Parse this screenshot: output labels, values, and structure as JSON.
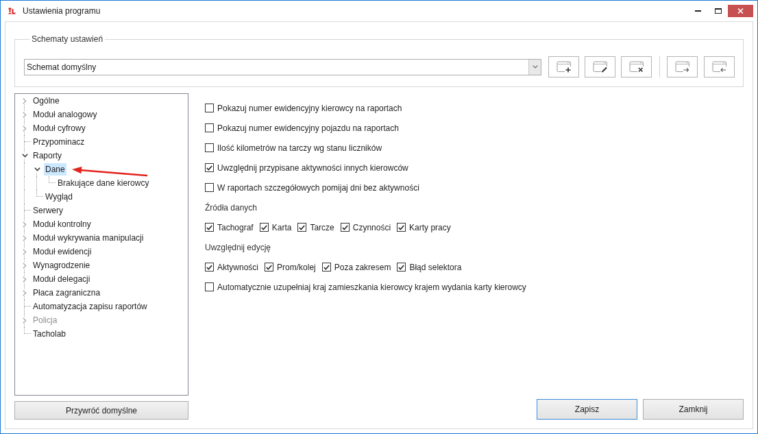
{
  "window": {
    "title": "Ustawienia programu"
  },
  "schemes": {
    "legend": "Schematy ustawień",
    "value": "Schemat domyślny"
  },
  "tree": [
    {
      "label": "Ogólne",
      "kind": "group",
      "expanded": false,
      "selected": false,
      "disabled": false
    },
    {
      "label": "Moduł analogowy",
      "kind": "group",
      "expanded": false,
      "selected": false,
      "disabled": false
    },
    {
      "label": "Moduł cyfrowy",
      "kind": "group",
      "expanded": false,
      "selected": false,
      "disabled": false
    },
    {
      "label": "Przypominacz",
      "kind": "leaf",
      "selected": false,
      "disabled": false
    },
    {
      "label": "Raporty",
      "kind": "group",
      "expanded": true,
      "selected": false,
      "disabled": false,
      "children": [
        {
          "label": "Dane",
          "kind": "group",
          "expanded": true,
          "selected": true,
          "disabled": false,
          "children": [
            {
              "label": "Brakujące dane kierowcy",
              "kind": "leaf",
              "selected": false,
              "disabled": false
            }
          ]
        },
        {
          "label": "Wygląd",
          "kind": "leaf",
          "selected": false,
          "disabled": false
        }
      ]
    },
    {
      "label": "Serwery",
      "kind": "leaf",
      "selected": false,
      "disabled": false
    },
    {
      "label": "Moduł kontrolny",
      "kind": "group",
      "expanded": false,
      "selected": false,
      "disabled": false
    },
    {
      "label": "Moduł wykrywania manipulacji",
      "kind": "group",
      "expanded": false,
      "selected": false,
      "disabled": false
    },
    {
      "label": "Moduł ewidencji",
      "kind": "group",
      "expanded": false,
      "selected": false,
      "disabled": false
    },
    {
      "label": "Wynagrodzenie",
      "kind": "group",
      "expanded": false,
      "selected": false,
      "disabled": false
    },
    {
      "label": "Moduł delegacji",
      "kind": "group",
      "expanded": false,
      "selected": false,
      "disabled": false
    },
    {
      "label": "Płaca zagraniczna",
      "kind": "group",
      "expanded": false,
      "selected": false,
      "disabled": false
    },
    {
      "label": "Automatyzacja zapisu raportów",
      "kind": "leaf",
      "selected": false,
      "disabled": false
    },
    {
      "label": "Policja",
      "kind": "group",
      "expanded": false,
      "selected": false,
      "disabled": true
    },
    {
      "label": "Tacholab",
      "kind": "leaf",
      "selected": false,
      "disabled": false
    }
  ],
  "settings": [
    {
      "kind": "checkbox",
      "label": "Pokazuj numer ewidencyjny kierowcy na raportach",
      "checked": false
    },
    {
      "kind": "checkbox",
      "label": "Pokazuj numer ewidencyjny pojazdu na raportach",
      "checked": false
    },
    {
      "kind": "checkbox",
      "label": "Ilość kilometrów na tarczy wg stanu liczników",
      "checked": false
    },
    {
      "kind": "checkbox",
      "label": "Uwzględnij przypisane aktywności innych kierowców",
      "checked": true
    },
    {
      "kind": "checkbox",
      "label": "W raportach szczegółowych pomijaj dni bez aktywności",
      "checked": false
    },
    {
      "kind": "heading",
      "label": "Źródła danych"
    },
    {
      "kind": "checkbox_row",
      "items": [
        {
          "label": "Tachograf",
          "checked": true
        },
        {
          "label": "Karta",
          "checked": true
        },
        {
          "label": "Tarcze",
          "checked": true
        },
        {
          "label": "Czynności",
          "checked": true
        },
        {
          "label": "Karty pracy",
          "checked": true
        }
      ]
    },
    {
      "kind": "heading",
      "label": "Uwzględnij edycję"
    },
    {
      "kind": "checkbox_row",
      "items": [
        {
          "label": "Aktywności",
          "checked": true
        },
        {
          "label": "Prom/kolej",
          "checked": true
        },
        {
          "label": "Poza zakresem",
          "checked": true
        },
        {
          "label": "Błąd selektora",
          "checked": true
        }
      ]
    },
    {
      "kind": "checkbox",
      "label": "Automatycznie uzupełniaj kraj zamieszkania kierowcy krajem wydania karty kierowcy",
      "checked": false
    }
  ],
  "restore_button": {
    "label": "Przywróć domyślne"
  },
  "buttons": [
    {
      "label": "Zapisz",
      "focused": true
    },
    {
      "label": "Zamknij",
      "focused": false
    }
  ]
}
